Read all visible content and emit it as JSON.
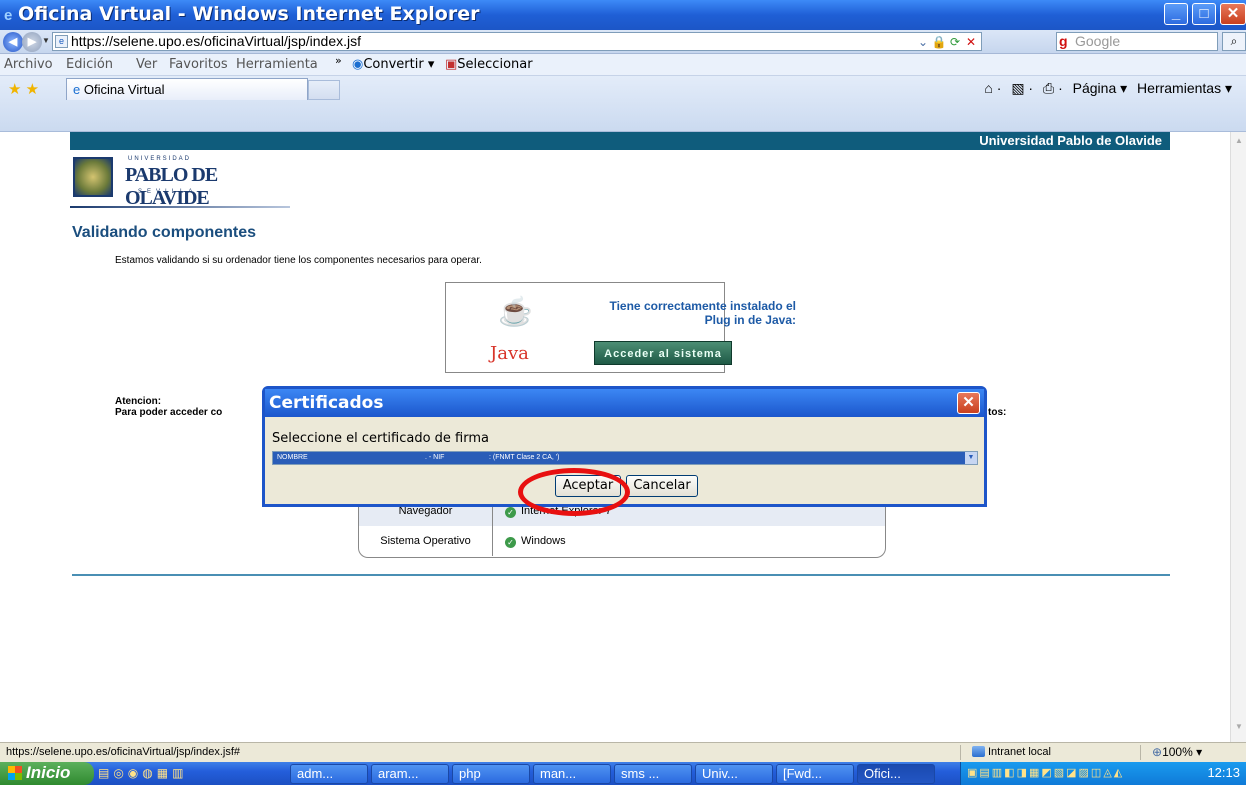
{
  "window": {
    "title": "Oficina Virtual - Windows Internet Explorer",
    "min": "_",
    "max": "□",
    "close": "✕"
  },
  "address": {
    "url": "https://selene.upo.es/oficinaVirtual/jsp/index.jsf",
    "search_placeholder": "Google"
  },
  "menu": {
    "items": [
      "Archivo",
      "Edición",
      "Ver",
      "Favoritos",
      "Herramienta"
    ],
    "more": "»",
    "convertir": "Convertir ▾",
    "seleccionar": "Seleccionar"
  },
  "tabs": {
    "active": "Oficina Virtual",
    "pagina": "Página ▾",
    "herramientas": "Herramientas ▾"
  },
  "page": {
    "university_band": "Universidad Pablo de Olavide",
    "logo_top": "UNIVERSIDAD",
    "logo_name": "PABLO DE OLAVIDE",
    "logo_city": "SEVILLA",
    "heading": "Validando componentes",
    "intro": "Estamos validando si su ordenador tiene los componentes necesarios para operar.",
    "java_msg_line1": "Tiene correctamente instalado el",
    "java_msg_line2": "Plug in de Java:",
    "java_word": "Java",
    "enter_button": "Acceder al sistema",
    "atencion_title": "Atencion:",
    "atencion_text": "Para poder acceder co",
    "atencion_tail": "tos:",
    "components": [
      {
        "label": "Navegador",
        "value": "Internet Explorer 7"
      },
      {
        "label": "Sistema Operativo",
        "value": "Windows"
      }
    ]
  },
  "dialog": {
    "title": "Certificados",
    "label": "Seleccione el certificado de firma",
    "selected_a": "NOMBRE",
    "selected_b": ". - NIF",
    "selected_c": ": (FNMT Clase 2 CA,                    ')",
    "ok": "Aceptar",
    "cancel": "Cancelar"
  },
  "status": {
    "url": "https://selene.upo.es/oficinaVirtual/jsp/index.jsf#",
    "zone": "Intranet local",
    "zoom": "100%"
  },
  "taskbar": {
    "start": "Inicio",
    "buttons": [
      "adm...",
      "aram...",
      "php",
      "man...",
      "sms ...",
      "Univ...",
      "[Fwd...",
      "Ofici..."
    ],
    "clock": "12:13"
  }
}
